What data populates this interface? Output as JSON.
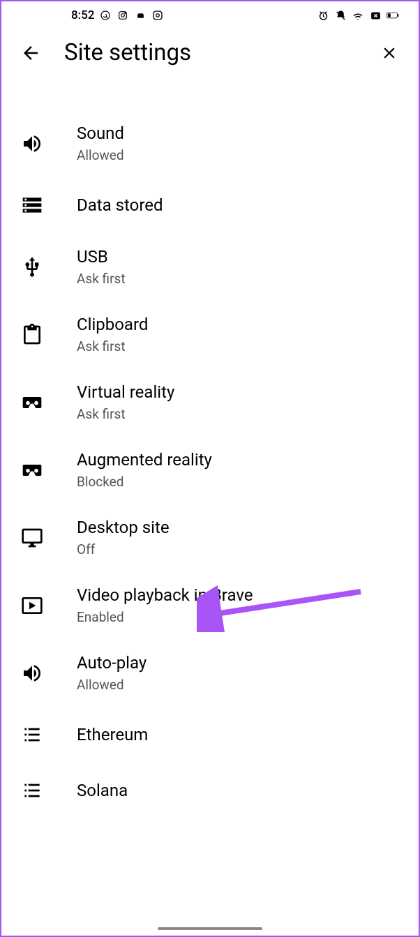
{
  "status": {
    "time": "8:52"
  },
  "header": {
    "title": "Site settings"
  },
  "settings": [
    {
      "title": "Sound",
      "subtitle": "Allowed"
    },
    {
      "title": "Data stored",
      "subtitle": ""
    },
    {
      "title": "USB",
      "subtitle": "Ask first"
    },
    {
      "title": "Clipboard",
      "subtitle": "Ask first"
    },
    {
      "title": "Virtual reality",
      "subtitle": "Ask first"
    },
    {
      "title": "Augmented reality",
      "subtitle": "Blocked"
    },
    {
      "title": "Desktop site",
      "subtitle": "Off"
    },
    {
      "title": "Video playback in Brave",
      "subtitle": "Enabled"
    },
    {
      "title": "Auto-play",
      "subtitle": "Allowed"
    },
    {
      "title": "Ethereum",
      "subtitle": ""
    },
    {
      "title": "Solana",
      "subtitle": ""
    }
  ]
}
